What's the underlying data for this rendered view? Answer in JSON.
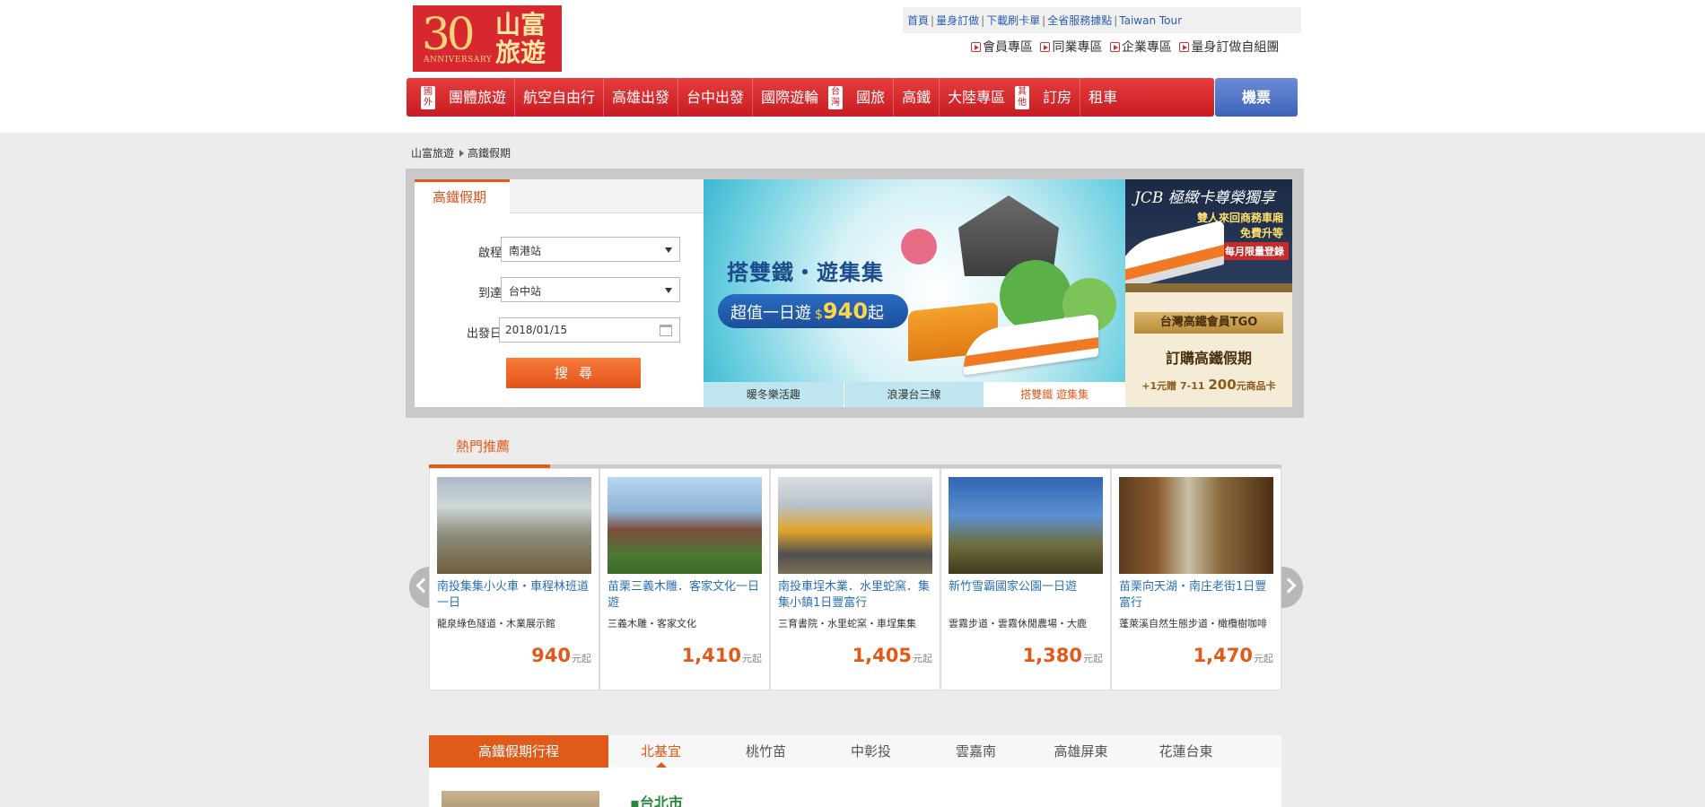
{
  "logo": {
    "number": "30",
    "anniversary": "ANNIVERSARY",
    "brand": "山富旅遊"
  },
  "toplinks": [
    "首頁",
    "量身訂做",
    "下載刷卡單",
    "全省服務據點",
    "Taiwan Tour"
  ],
  "zones": [
    "會員專區",
    "同業專區",
    "企業專區",
    "量身訂做自組團"
  ],
  "nav": {
    "tag_abroad": "國外",
    "abroad": [
      "團體旅遊",
      "航空自由行",
      "高雄出發",
      "台中出發",
      "國際遊輪"
    ],
    "tag_taiwan": "台灣",
    "taiwan": [
      "國旅",
      "高鐵",
      "大陸專區"
    ],
    "tag_other": "其他",
    "other": [
      "訂房",
      "租車"
    ],
    "ticket": "機票"
  },
  "breadcrumb": [
    "山富旅遊",
    "高鐵假期"
  ],
  "search": {
    "tab": "高鐵假期",
    "depart_label": "啟程站",
    "depart_value": "南港站",
    "arrive_label": "到達站",
    "arrive_value": "台中站",
    "date_label": "出發日期",
    "date_value": "2018/01/15",
    "button": "搜尋"
  },
  "banner": {
    "title": "搭雙鐵・遊集集",
    "pill_prefix": "超值一日遊",
    "currency": "$",
    "price": "940",
    "suffix": "起",
    "tabs": [
      "暖冬樂活趣",
      "浪漫台三線",
      "搭雙鐵 遊集集"
    ]
  },
  "ad_jcb": {
    "title": "JCB 極緻卡尊榮獨享",
    "line1": "雙人來回商務車廂",
    "line2": "免費升等",
    "badge": "每月限量登錄"
  },
  "ad_tgo": {
    "ribbon": "台灣高鐵會員TGO",
    "title": "訂購高鐵假期",
    "promo_prefix": "+1元贈 7-11",
    "promo_amount": "200",
    "promo_suffix": "元商品卡"
  },
  "hot": {
    "tab": "熱門推薦",
    "unit": "元起",
    "items": [
      {
        "title": "南投集集小火車・車程林班道一日",
        "sub": "龍泉綠色隧道・木業展示館",
        "price": "940"
      },
      {
        "title": "苗栗三義木雕．客家文化一日遊",
        "sub": "三義木雕・客家文化",
        "price": "1,410"
      },
      {
        "title": "南投車埕木業．水里蛇窯．集集小鎮1日豐富行",
        "sub": "三育書院・水里蛇窯・車埕集集",
        "price": "1,405"
      },
      {
        "title": "新竹雪霸國家公園一日遊",
        "sub": "雲霧步道・雲霧休閒農場・大鹿",
        "price": "1,380"
      },
      {
        "title": "苗栗向天湖・南庄老街1日豐富行",
        "sub": "蓬萊溪自然生態步道・橄欖樹咖啡",
        "price": "1,470"
      }
    ]
  },
  "tour": {
    "title": "高鐵假期行程",
    "regions": [
      "北基宜",
      "桃竹苗",
      "中彰投",
      "雲嘉南",
      "高雄屏東",
      "花蓮台東"
    ],
    "city": "▪台北市"
  }
}
